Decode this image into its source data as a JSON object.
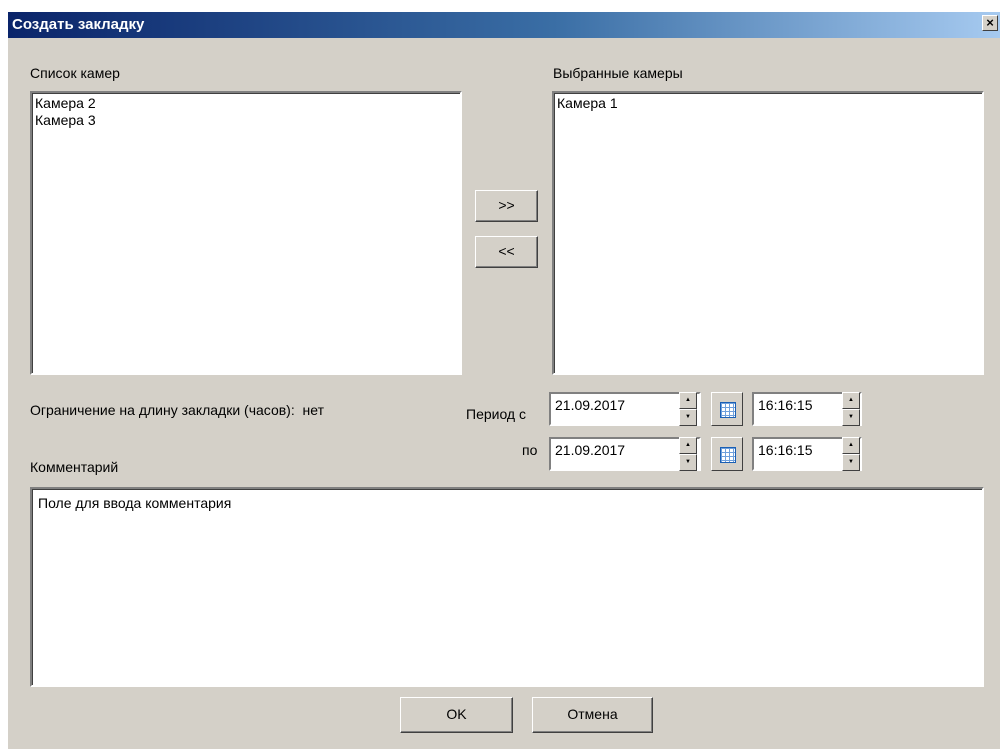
{
  "dialog": {
    "title": "Создать закладку",
    "close_glyph": "×"
  },
  "cameras": {
    "available_label": "Список камер",
    "available": [
      "Камера 2",
      "Камера 3"
    ],
    "selected_label": "Выбранные камеры",
    "selected": [
      "Камера 1"
    ],
    "add_button": ">>",
    "remove_button": "<<"
  },
  "limit": {
    "label": "Ограничение на длину закладки (часов):",
    "value": "нет"
  },
  "period": {
    "from_label": "Период с",
    "to_label": "по",
    "from_date": "21.09.2017",
    "from_time": "16:16:15",
    "to_date": "21.09.2017",
    "to_time": "16:16:15",
    "icons": {
      "spinner": "spin-up-down-icon",
      "calendar": "calendar-icon"
    }
  },
  "comment": {
    "label": "Комментарий",
    "value": "Поле для ввода комментария"
  },
  "buttons": {
    "ok": "OK",
    "cancel": "Отмена"
  }
}
